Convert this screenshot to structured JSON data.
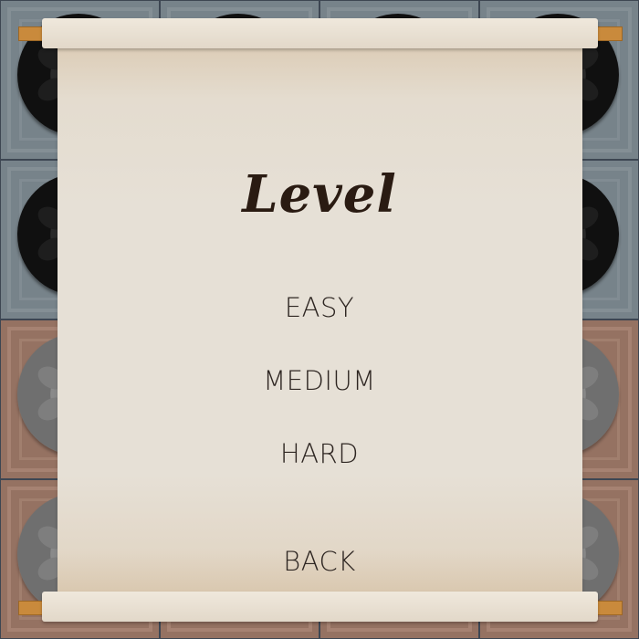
{
  "screen": {
    "title": "Level",
    "options": {
      "easy": "EASY",
      "medium": "MEDIUM",
      "hard": "HARD"
    },
    "back": "BACK"
  },
  "colors": {
    "paper": "#e6e0d6",
    "text": "#2e2622",
    "title": "#2a1b12",
    "rod_peg": "#c98a3c",
    "board_slate": "#77838a",
    "board_clay": "#957262"
  }
}
